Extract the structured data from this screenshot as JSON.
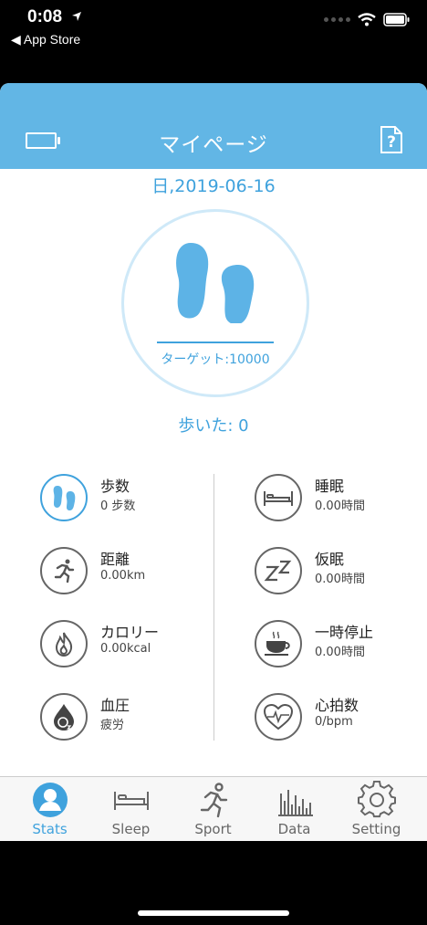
{
  "status_bar": {
    "time": "0:08",
    "back_label": "◀ App Store"
  },
  "header": {
    "title": "マイページ",
    "help_icon_text": "?"
  },
  "date": "日,2019-06-16",
  "target_text": "ターゲット:10000",
  "walked_text": "歩いた: 0",
  "stats_left": [
    {
      "name": "歩数",
      "value": "0 步数",
      "icon": "footsteps-icon"
    },
    {
      "name": "距離",
      "value": "0.00km",
      "icon": "runner-icon"
    },
    {
      "name": "カロリー",
      "value": "0.00kcal",
      "icon": "flame-icon"
    },
    {
      "name": "血圧",
      "value": "疲労",
      "icon": "oxygen-drop-icon"
    }
  ],
  "stats_right": [
    {
      "name": "睡眠",
      "value": "0.00時間",
      "icon": "bed-icon"
    },
    {
      "name": "仮眠",
      "value": "0.00時間",
      "icon": "zz-icon"
    },
    {
      "name": "一時停止",
      "value": "0.00時間",
      "icon": "coffee-cup-icon"
    },
    {
      "name": "心拍数",
      "value": "0/bpm",
      "icon": "heart-rate-icon"
    }
  ],
  "tabs": [
    {
      "label": "Stats",
      "icon": "person-icon",
      "active": true
    },
    {
      "label": "Sleep",
      "icon": "bed-icon",
      "active": false
    },
    {
      "label": "Sport",
      "icon": "runner-icon",
      "active": false
    },
    {
      "label": "Data",
      "icon": "bar-chart-icon",
      "active": false
    },
    {
      "label": "Setting",
      "icon": "gear-icon",
      "active": false
    }
  ],
  "colors": {
    "accent": "#3fa2dd",
    "header": "#62b6e5"
  }
}
